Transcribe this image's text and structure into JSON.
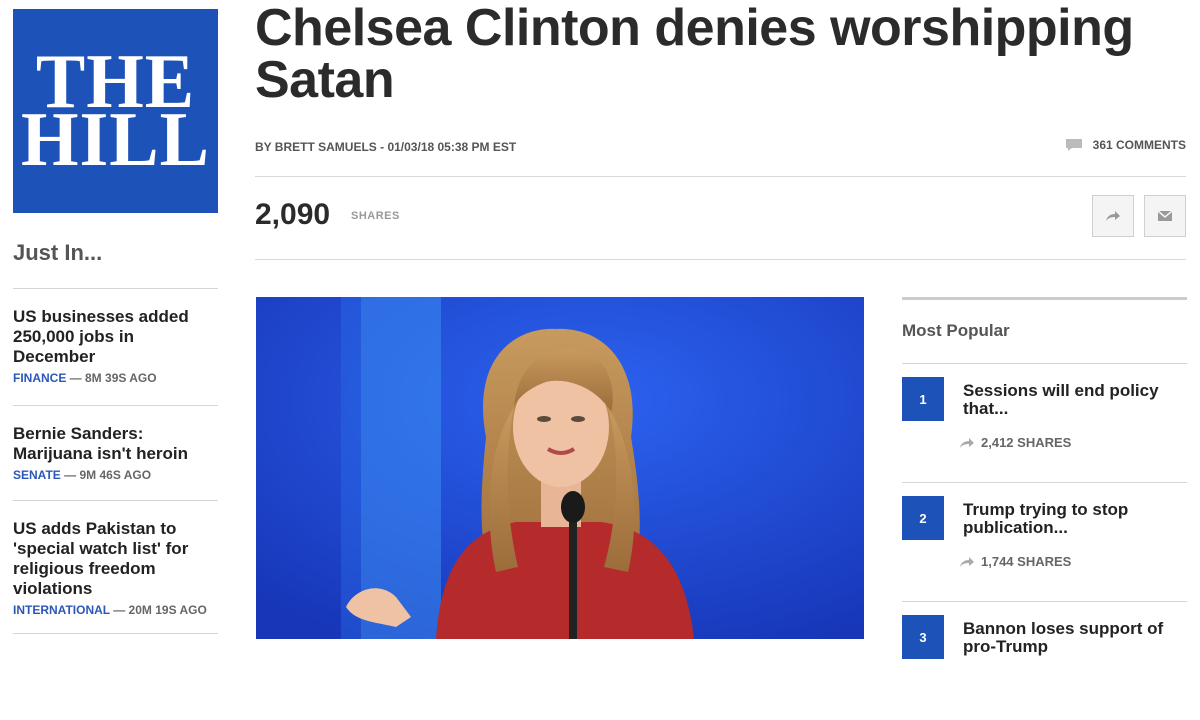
{
  "logo": {
    "line1": "THE",
    "line2": "HILL"
  },
  "sidebar": {
    "title": "Just In...",
    "items": [
      {
        "headline": "US businesses added 250,000 jobs in December",
        "category": "FINANCE",
        "time": " — 8M 39S AGO"
      },
      {
        "headline": "Bernie Sanders: Marijuana isn't heroin",
        "category": "SENATE",
        "time": " — 9M 46S AGO"
      },
      {
        "headline": "US adds Pakistan to 'special watch list' for religious freedom violations",
        "category": "INTERNATIONAL",
        "time": " — 20M 19S AGO"
      }
    ]
  },
  "article": {
    "title": "Chelsea Clinton denies worshipping Satan",
    "byline": "BY BRETT SAMUELS - 01/03/18 05:38 PM EST",
    "comments": "361 COMMENTS",
    "shares_count": "2,090",
    "shares_label": "SHARES"
  },
  "popular": {
    "title": "Most Popular",
    "items": [
      {
        "rank": "1",
        "headline": "Sessions will end policy that...",
        "shares": "2,412 SHARES"
      },
      {
        "rank": "2",
        "headline": "Trump trying to stop publication...",
        "shares": "1,744 SHARES"
      },
      {
        "rank": "3",
        "headline": "Bannon loses support of pro-Trump",
        "shares": ""
      }
    ]
  },
  "icons": {
    "comment": "comment-icon",
    "share": "share-arrow-icon",
    "email": "email-icon"
  },
  "colors": {
    "brand_blue": "#1d52b8",
    "category_blue": "#2a57b8"
  }
}
